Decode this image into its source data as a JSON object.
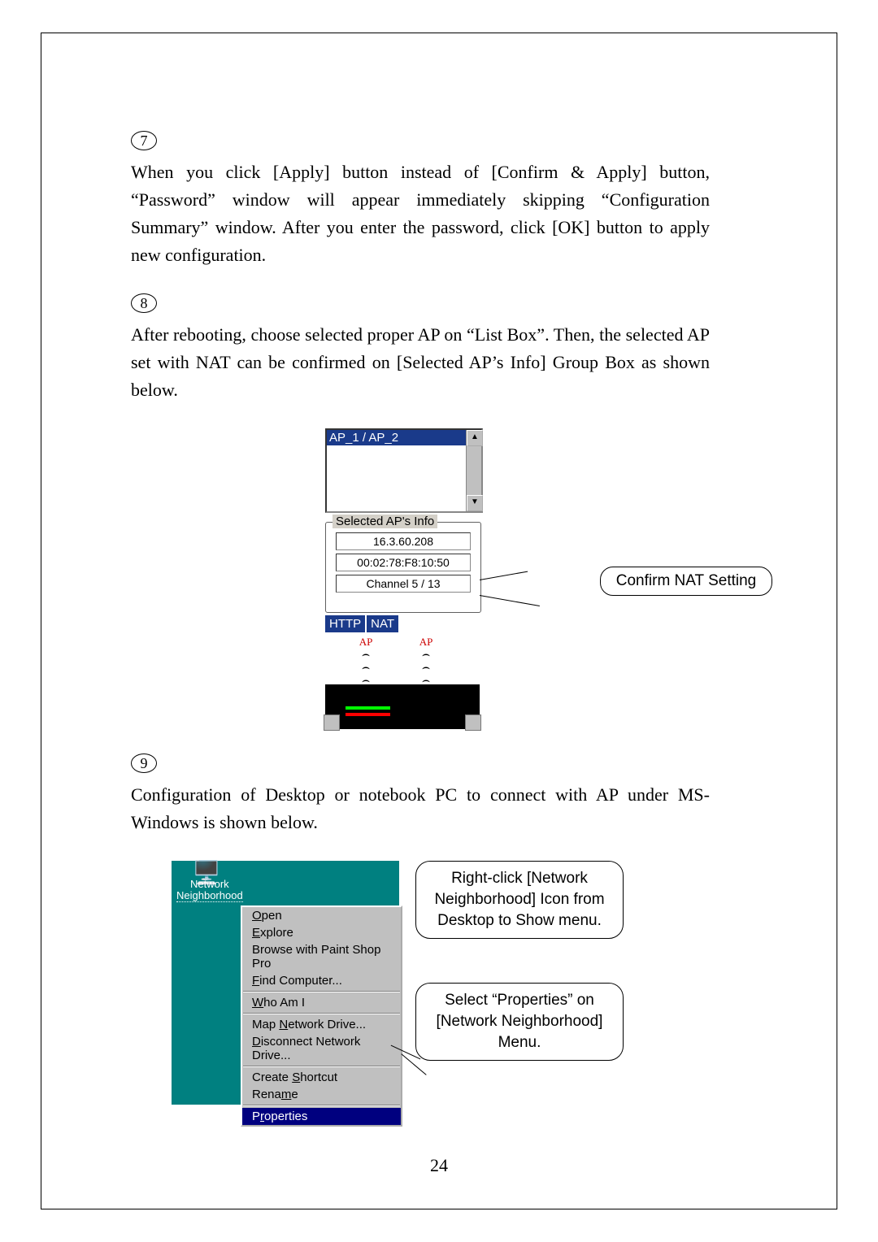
{
  "steps": {
    "s7": {
      "num": "7",
      "text": "When you click [Apply] button instead of [Confirm & Apply] button, “Password” window will appear immediately skipping “Configuration Summary” window. After you enter the password, click [OK] button to apply new configuration."
    },
    "s8": {
      "num": "8",
      "text": "After rebooting, choose selected proper AP on “List Box”. Then, the selected AP set with NAT can be confirmed on [Selected AP’s Info] Group Box as shown below."
    },
    "s9": {
      "num": "9",
      "text": "Configuration of Desktop or notebook PC to connect with AP under MS-Windows is shown below."
    }
  },
  "fig1": {
    "listbox": {
      "row": "AP_1             /  AP_2"
    },
    "group": {
      "title": "Selected AP's Info",
      "ip": "16.3.60.208",
      "mac": "00:02:78:F8:10:50",
      "ch": "Channel 5 / 13"
    },
    "chips": {
      "http": "HTTP",
      "nat": "NAT"
    },
    "ap_label": "AP",
    "callout": "Confirm NAT Setting"
  },
  "fig2": {
    "icon_label": "Network Neighborhood",
    "menu": {
      "open": "Open",
      "explore": "Explore",
      "browse": "Browse with Paint Shop Pro",
      "find": "Find Computer...",
      "who": "Who Am I",
      "map": "Map Network Drive...",
      "disc": "Disconnect Network Drive...",
      "shortcut": "Create Shortcut",
      "rename": "Rename",
      "props": "Properties"
    },
    "callout1": "Right-click [Network Neighborhood] Icon from Desktop to Show menu.",
    "callout2": "Select “Properties” on [Network Neighborhood] Menu."
  },
  "page_number": "24"
}
